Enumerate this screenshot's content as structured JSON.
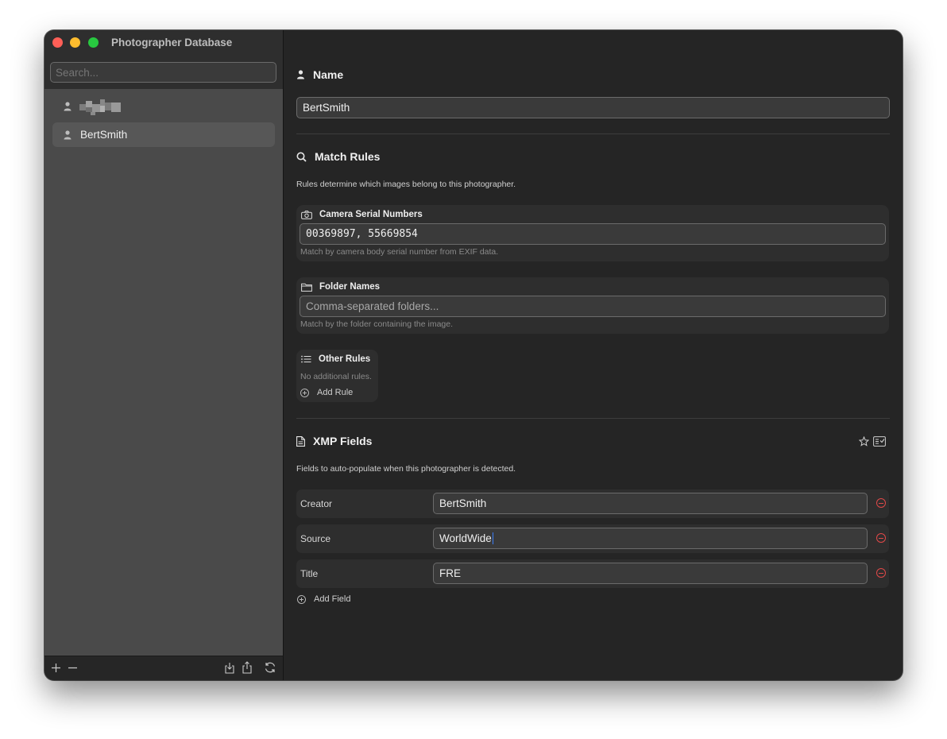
{
  "window": {
    "title": "Photographer Database"
  },
  "sidebar": {
    "search_placeholder": "Search...",
    "items": [
      {
        "label": "",
        "redacted": true
      },
      {
        "label": "BertSmith",
        "selected": true
      }
    ],
    "bottom_icons": [
      "plus-icon",
      "minus-icon",
      "import-icon",
      "export-icon",
      "refresh-icon"
    ]
  },
  "name_section": {
    "heading": "Name",
    "value": "BertSmith"
  },
  "match_rules": {
    "heading": "Match Rules",
    "description": "Rules determine which images belong to this photographer.",
    "camera": {
      "title": "Camera Serial Numbers",
      "value": "00369897, 55669854",
      "hint": "Match by camera body serial number from EXIF data."
    },
    "folders": {
      "title": "Folder Names",
      "value": "",
      "placeholder": "Comma-separated folders...",
      "hint": "Match by the folder containing the image."
    },
    "other": {
      "title": "Other Rules",
      "empty_text": "No additional rules.",
      "add_label": "Add Rule"
    }
  },
  "xmp": {
    "heading": "XMP Fields",
    "description": "Fields to auto-populate when this photographer is detected.",
    "fields": [
      {
        "label": "Creator",
        "value": "BertSmith"
      },
      {
        "label": "Source",
        "value": "WorldWide"
      },
      {
        "label": "Title",
        "value": "FRE"
      }
    ],
    "add_label": "Add Field"
  },
  "colors": {
    "accent": "#3b7cf6",
    "remove": "#e04848",
    "sidebar": "#4a4a4a",
    "content": "#252525"
  }
}
